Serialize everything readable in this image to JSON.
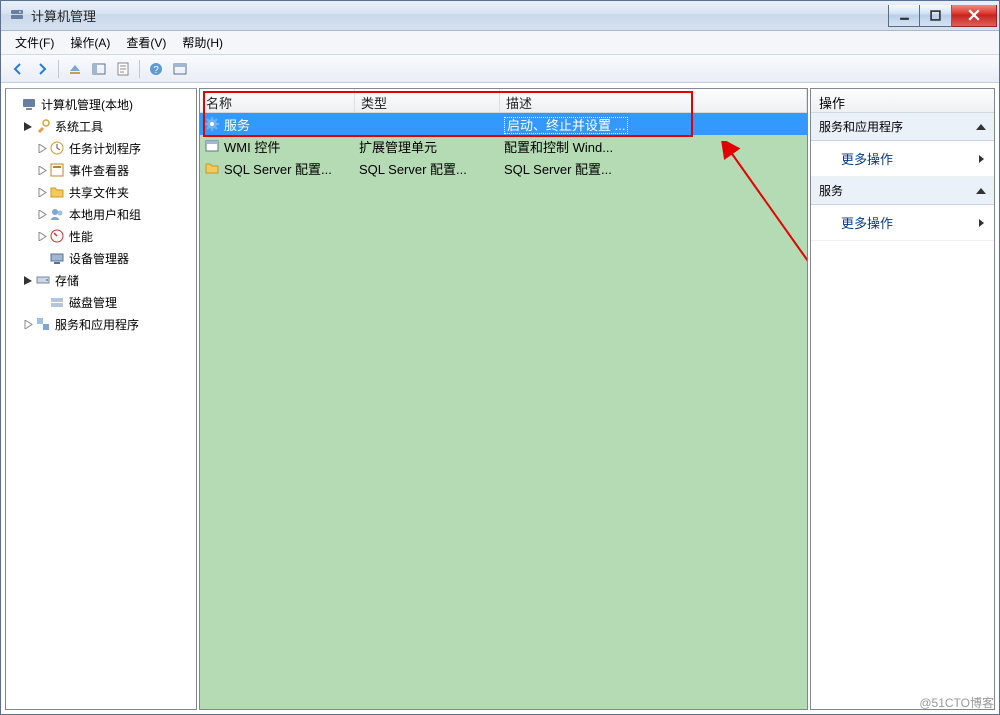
{
  "title": "计算机管理",
  "menubar": [
    "文件(F)",
    "操作(A)",
    "查看(V)",
    "帮助(H)"
  ],
  "tree": {
    "root": "计算机管理(本地)",
    "sys_tools": "系统工具",
    "task_scheduler": "任务计划程序",
    "event_viewer": "事件查看器",
    "shared_folders": "共享文件夹",
    "local_users": "本地用户和组",
    "performance": "性能",
    "device_manager": "设备管理器",
    "storage": "存储",
    "disk_mgmt": "磁盘管理",
    "services_apps": "服务和应用程序"
  },
  "list": {
    "headers": {
      "name": "名称",
      "type": "类型",
      "desc": "描述"
    },
    "rows": [
      {
        "name": "服务",
        "type": "",
        "desc": "启动、终止并设置 ..."
      },
      {
        "name": "WMI 控件",
        "type": "扩展管理单元",
        "desc": "配置和控制 Wind..."
      },
      {
        "name": "SQL Server 配置...",
        "type": "SQL Server 配置...",
        "desc": "SQL Server 配置..."
      }
    ]
  },
  "actions": {
    "title": "操作",
    "section1": "服务和应用程序",
    "more1": "更多操作",
    "section2": "服务",
    "more2": "更多操作"
  },
  "watermark": "@51CTO博客"
}
